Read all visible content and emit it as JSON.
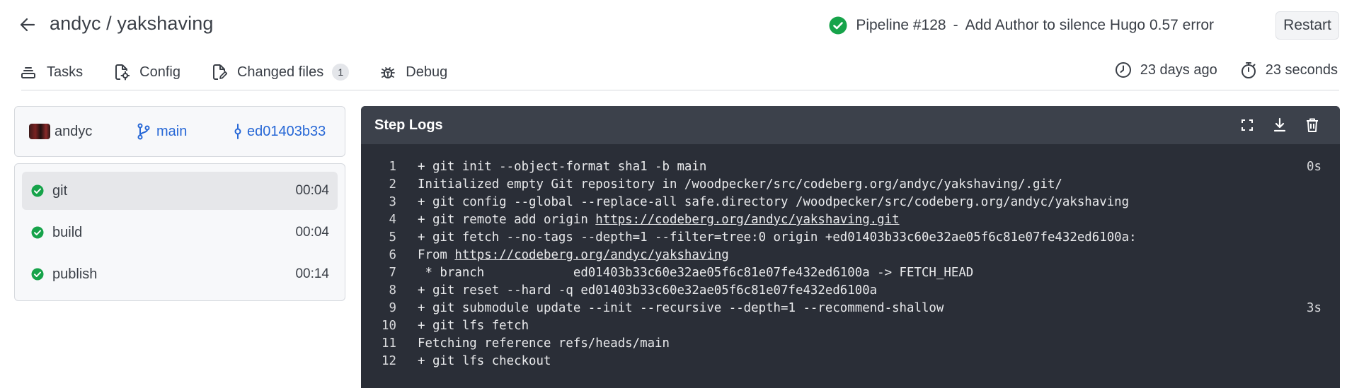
{
  "header": {
    "repo_title": "andyc / yakshaving",
    "pipeline_label": "Pipeline #128",
    "separator": "-",
    "pipeline_message": "Add Author to silence Hugo 0.57 error",
    "restart_label": "Restart",
    "status": "success",
    "status_color": "#16a34a"
  },
  "tabs": [
    {
      "label": "Tasks",
      "icon": "tasks-icon"
    },
    {
      "label": "Config",
      "icon": "config-file-icon"
    },
    {
      "label": "Changed files",
      "icon": "changed-files-icon",
      "count": "1"
    },
    {
      "label": "Debug",
      "icon": "bug-icon"
    }
  ],
  "meta": {
    "created": "23 days ago",
    "duration": "23 seconds"
  },
  "commit": {
    "author": "andyc",
    "branch": "main",
    "sha": "ed01403b33",
    "link_color": "#2667d6"
  },
  "steps": [
    {
      "name": "git",
      "duration": "00:04",
      "active": true
    },
    {
      "name": "build",
      "duration": "00:04",
      "active": false
    },
    {
      "name": "publish",
      "duration": "00:14",
      "active": false
    }
  ],
  "log": {
    "title": "Step Logs",
    "lines": [
      {
        "num": "1",
        "pre": "+ git init --object-format sha1 -b main",
        "link": "",
        "post": "",
        "time": "0s"
      },
      {
        "num": "2",
        "pre": "Initialized empty Git repository in /woodpecker/src/codeberg.org/andyc/yakshaving/.git/",
        "link": "",
        "post": "",
        "time": ""
      },
      {
        "num": "3",
        "pre": "+ git config --global --replace-all safe.directory /woodpecker/src/codeberg.org/andyc/yakshaving",
        "link": "",
        "post": "",
        "time": ""
      },
      {
        "num": "4",
        "pre": "+ git remote add origin ",
        "link": "https://codeberg.org/andyc/yakshaving.git",
        "post": "",
        "time": ""
      },
      {
        "num": "5",
        "pre": "+ git fetch --no-tags --depth=1 --filter=tree:0 origin +ed01403b33c60e32ae05f6c81e07fe432ed6100a:",
        "link": "",
        "post": "",
        "time": ""
      },
      {
        "num": "6",
        "pre": "From ",
        "link": "https://codeberg.org/andyc/yakshaving",
        "post": "",
        "time": ""
      },
      {
        "num": "7",
        "pre": " * branch            ed01403b33c60e32ae05f6c81e07fe432ed6100a -> FETCH_HEAD",
        "link": "",
        "post": "",
        "time": ""
      },
      {
        "num": "8",
        "pre": "+ git reset --hard -q ed01403b33c60e32ae05f6c81e07fe432ed6100a",
        "link": "",
        "post": "",
        "time": ""
      },
      {
        "num": "9",
        "pre": "+ git submodule update --init --recursive --depth=1 --recommend-shallow",
        "link": "",
        "post": "",
        "time": "3s"
      },
      {
        "num": "10",
        "pre": "+ git lfs fetch",
        "link": "",
        "post": "",
        "time": ""
      },
      {
        "num": "11",
        "pre": "Fetching reference refs/heads/main",
        "link": "",
        "post": "",
        "time": ""
      },
      {
        "num": "12",
        "pre": "+ git lfs checkout",
        "link": "",
        "post": "",
        "time": ""
      }
    ]
  }
}
